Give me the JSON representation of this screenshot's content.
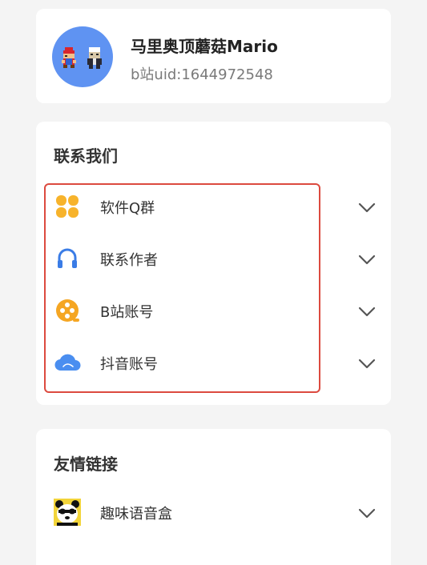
{
  "profile": {
    "name": "马里奥顶蘑菇Mario",
    "uid": "b站uid:1644972548",
    "avatar_icon": "pixel-mario-avatar"
  },
  "contact": {
    "title": "联系我们",
    "items": [
      {
        "label": "软件Q群",
        "icon": "four-petal-icon",
        "color": "#f7b32b"
      },
      {
        "label": "联系作者",
        "icon": "headphones-icon",
        "color": "#3a7ce6"
      },
      {
        "label": "B站账号",
        "icon": "film-reel-icon",
        "color": "#f5a623"
      },
      {
        "label": "抖音账号",
        "icon": "cloud-icon",
        "color": "#4a8ef0"
      }
    ]
  },
  "links": {
    "title": "友情链接",
    "items": [
      {
        "label": "趣味语音盒",
        "icon": "panda-avatar-icon"
      }
    ]
  },
  "colors": {
    "background": "#f4f4f4",
    "card": "#ffffff",
    "highlight": "#dc4a3f",
    "avatar_bg": "#5f93f2"
  }
}
